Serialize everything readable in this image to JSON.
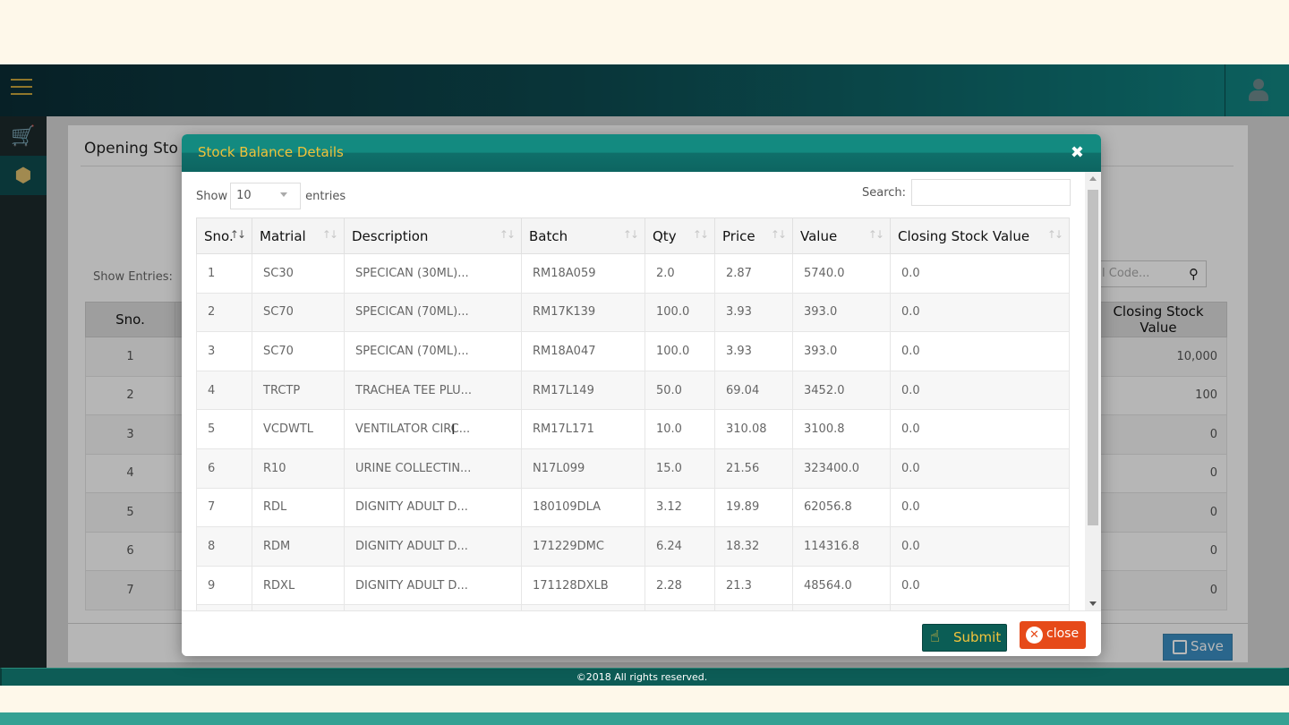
{
  "page": {
    "title_visible": "Opening Sto",
    "show_entries_label": "Show Entries:",
    "code_search_placeholder": "l Code...",
    "save_label": "Save",
    "copyright": "©2018 All rights reserved."
  },
  "bg_table": {
    "col_sno": "Sno.",
    "col_csv": "Closing Stock Value",
    "rows": [
      {
        "sno": "1",
        "csv": "10,000"
      },
      {
        "sno": "2",
        "csv": "100"
      },
      {
        "sno": "3",
        "csv": "0"
      },
      {
        "sno": "4",
        "csv": "0"
      },
      {
        "sno": "5",
        "csv": "0"
      },
      {
        "sno": "6",
        "csv": "0"
      },
      {
        "sno": "7",
        "csv": "0"
      }
    ]
  },
  "modal": {
    "title": "Stock Balance Details",
    "close_x": "✖",
    "show_label": "Show",
    "entries_label": "entries",
    "page_size": "10",
    "search_label": "Search:",
    "search_value": "",
    "submit_label": "Submit",
    "close_label": "close",
    "columns": [
      "Sno.",
      "Matrial",
      "Description",
      "Batch",
      "Qty",
      "Price",
      "Value",
      "Closing Stock Value"
    ],
    "rows": [
      [
        "1",
        "SC30",
        "SPECICAN (30ML)...",
        "RM18A059",
        "2.0",
        "2.87",
        "5740.0",
        "0.0"
      ],
      [
        "2",
        "SC70",
        "SPECICAN (70ML)...",
        "RM17K139",
        "100.0",
        "3.93",
        "393.0",
        "0.0"
      ],
      [
        "3",
        "SC70",
        "SPECICAN (70ML)...",
        "RM18A047",
        "100.0",
        "3.93",
        "393.0",
        "0.0"
      ],
      [
        "4",
        "TRCTP",
        "TRACHEA TEE PLU...",
        "RM17L149",
        "50.0",
        "69.04",
        "3452.0",
        "0.0"
      ],
      [
        "5",
        "VCDWTL",
        "VENTILATOR CIRC...",
        "RM17L171",
        "10.0",
        "310.08",
        "3100.8",
        "0.0"
      ],
      [
        "6",
        "R10",
        "URINE COLLECTIN...",
        "N17L099",
        "15.0",
        "21.56",
        "323400.0",
        "0.0"
      ],
      [
        "7",
        "RDL",
        "DIGNITY ADULT D...",
        "180109DLA",
        "3.12",
        "19.89",
        "62056.8",
        "0.0"
      ],
      [
        "8",
        "RDM",
        "DIGNITY ADULT D...",
        "171229DMC",
        "6.24",
        "18.32",
        "114316.8",
        "0.0"
      ],
      [
        "9",
        "RDXL",
        "DIGNITY ADULT D...",
        "171128DXLB",
        "2.28",
        "21.3",
        "48564.0",
        "0.0"
      ],
      [
        "",
        "",
        "",
        "",
        "",
        "",
        "",
        ""
      ]
    ]
  },
  "icons": {
    "menu": "hamburger-icon",
    "user": "user-icon",
    "cart": "cart-icon",
    "stock": "boxes-icon",
    "search": "search-icon",
    "save": "floppy-icon",
    "submit": "hand-pointer-icon",
    "close": "x-circle-icon"
  },
  "colors": {
    "header_teal": "#0e6f70",
    "modal_title": "#f0c23a",
    "submit_bg": "#0b5d55",
    "close_bg": "#e64a19",
    "save_bg": "#3b8ec2"
  }
}
